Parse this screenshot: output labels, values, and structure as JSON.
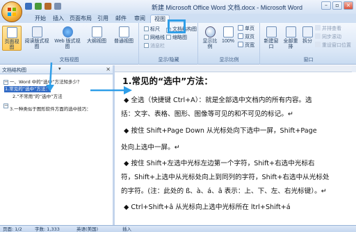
{
  "window": {
    "title": "新建 Microsoft Office Word 文档.docx - Microsoft Word",
    "controls": [
      "–",
      "▫",
      "×"
    ]
  },
  "tabs": [
    "开始",
    "插入",
    "页面布局",
    "引用",
    "邮件",
    "审阅",
    "视图"
  ],
  "active_tab": "视图",
  "ribbon": {
    "doc_views": {
      "label": "文档视图",
      "buttons": [
        "页面视图",
        "阅读版式视图",
        "Web 版式视图",
        "大纲视图",
        "普通视图"
      ]
    },
    "show_hide": {
      "label": "显示/隐藏",
      "checkboxes": [
        "标尺",
        "网格线",
        "消息栏",
        "文档结构图",
        "缩略图"
      ]
    },
    "zoom": {
      "label": "显示比例",
      "buttons": [
        "显示比例",
        "100%"
      ],
      "small": [
        "单页",
        "双页",
        "页宽"
      ]
    },
    "window": {
      "label": "窗口",
      "buttons": [
        "新建窗口",
        "全部重排",
        "拆分"
      ],
      "small": [
        "并排查看",
        "同步滚动",
        "重设窗口位置"
      ]
    }
  },
  "nav_pane": {
    "title": "文档结构图",
    "items": [
      "一、Word 中的“选中”方法知多少？",
      "1.常见的“选中”方法：",
      "2.“不常用”的“选中”方法",
      "3.一种类似于图形软件方面的选中技巧："
    ]
  },
  "document": {
    "heading": "1.常见的“选中”方法：",
    "lines": [
      "◆ 全选（快捷键 Ctrl+A）：就是全部选中文档内的所有内容。选",
      "括：文字、表格、图形、图像等可见的和不可见的标记。↵",
      "◆ 按住 Shift+Page Down 从光标处向下选中一屏，Shift+Page",
      "处向上选中一屏。↵",
      "◆ 按住 Shift+左选中光标左边第一个字符，Shift+右选中光标右",
      "符，Shift+上选中从光标处向上到同列的字符，Shift+右选中从光标处",
      "的字符。(注：此处的 ß、à、á、â 表示：上、下、左、右光标键）。↵",
      "◆ Ctrl+Shift+â 从光标向上选中光标所在       ltrl+Shift+á"
    ]
  },
  "status_bar": {
    "page": "页面: 1/2",
    "words": "字数: 1,333",
    "lang": "英语(美国)",
    "mode": "插入"
  },
  "colors": {
    "highlight": "#2f9ee8",
    "selected_nav": "#316ac5"
  }
}
